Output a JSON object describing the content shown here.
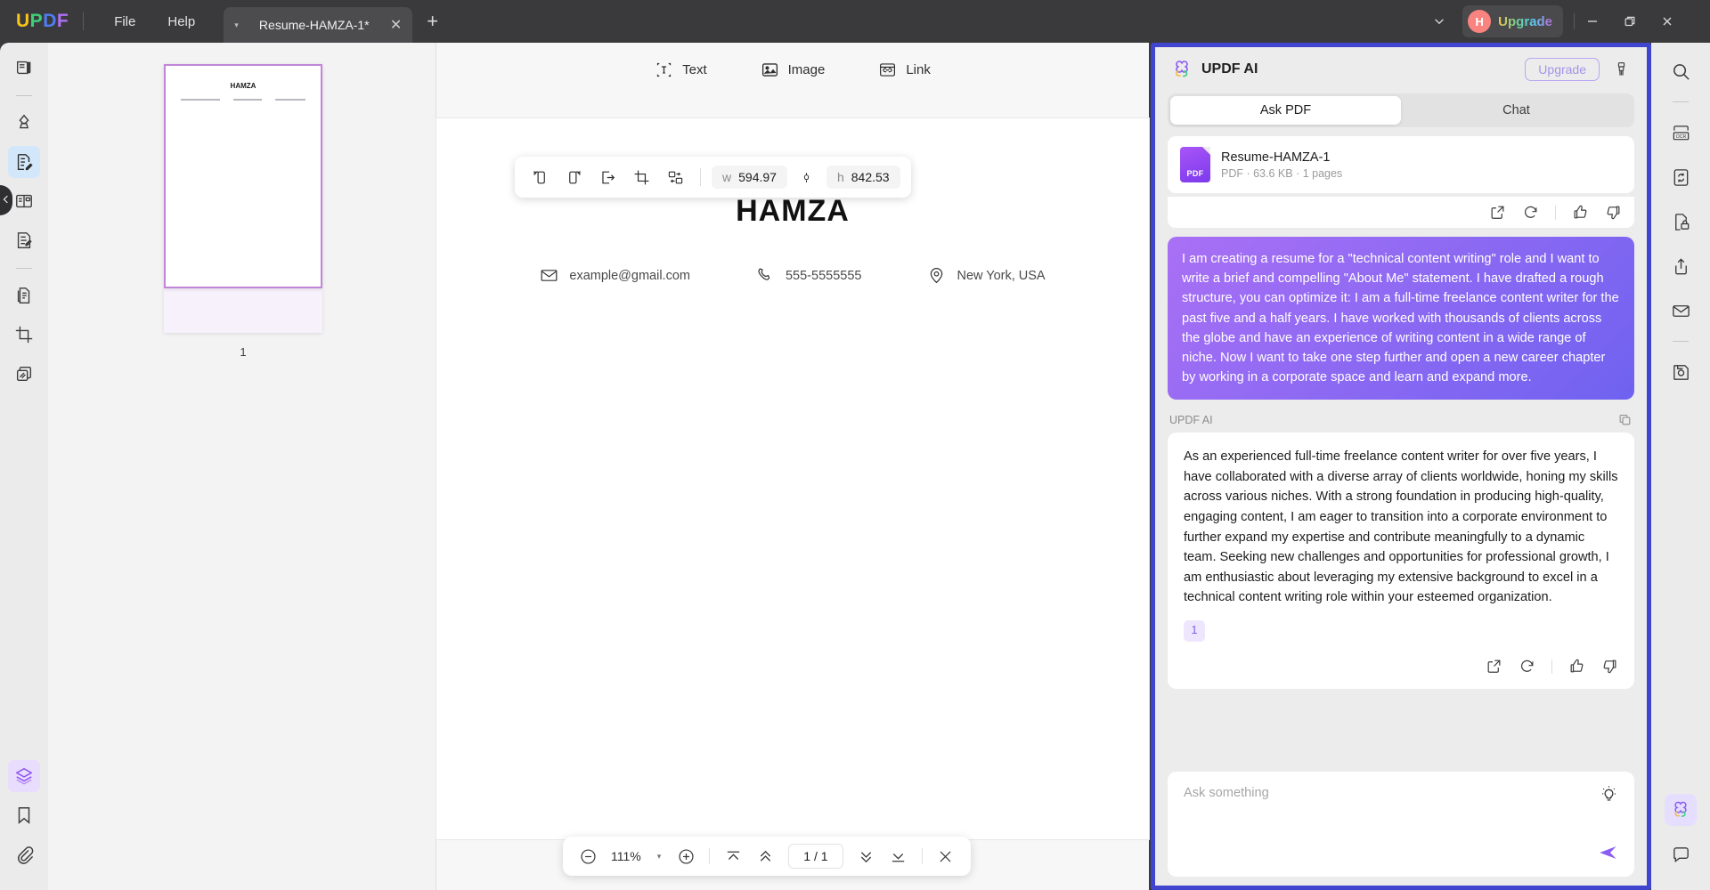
{
  "titlebar": {
    "logo": "UPDF",
    "menu": [
      {
        "label": "File"
      },
      {
        "label": "Help"
      }
    ],
    "tab": {
      "title": "Resume-HAMZA-1*",
      "close": "✕",
      "caret": "▾"
    },
    "new_tab": "+",
    "chevron": "⌄",
    "avatar_initial": "H",
    "upgrade_label": "Upgrade",
    "window": {
      "minimize": "—",
      "maximize": "❐",
      "close": "✕"
    }
  },
  "left_rail": {
    "items": [
      {
        "name": "reader-icon",
        "label": "Reader"
      },
      {
        "name": "comment-highlight-icon",
        "label": "Comment"
      },
      {
        "name": "edit-pdf-icon",
        "label": "Edit PDF",
        "active": true
      },
      {
        "name": "page-organize-icon",
        "label": "Organize Pages"
      },
      {
        "name": "form-edit-icon",
        "label": "Prepare Form"
      },
      {
        "name": "convert-icon",
        "label": "Convert"
      },
      {
        "name": "crop-icon",
        "label": "Crop"
      },
      {
        "name": "batch-icon",
        "label": "Batch"
      }
    ],
    "bottom_items": [
      {
        "name": "layers-icon",
        "label": "Layers",
        "active": true
      },
      {
        "name": "bookmark-icon",
        "label": "Bookmark"
      },
      {
        "name": "attachment-icon",
        "label": "Attachment"
      }
    ]
  },
  "thumbnails": {
    "page_label": "1",
    "doc_title": "HAMZA"
  },
  "edit_toolbar": [
    {
      "icon": "text-icon",
      "label": "Text"
    },
    {
      "icon": "image-icon",
      "label": "Image"
    },
    {
      "icon": "link-icon",
      "label": "Link"
    }
  ],
  "float_toolbar": {
    "buttons": [
      {
        "name": "rotate-left-icon"
      },
      {
        "name": "rotate-right-icon"
      },
      {
        "name": "extract-image-icon"
      },
      {
        "name": "crop-image-icon"
      },
      {
        "name": "replace-image-icon"
      }
    ],
    "width_label": "w",
    "width_value": "594.97",
    "lock_ratio_icon": "link-ratio-icon",
    "height_label": "h",
    "height_value": "842.53"
  },
  "document": {
    "name": "HAMZA",
    "email": "example@gmail.com",
    "phone": "555-5555555",
    "location": "New York, USA"
  },
  "zoombar": {
    "zoom_out": "−",
    "zoom_level": "111%",
    "dropdown_caret": "▾",
    "zoom_in": "+",
    "page_indicator": "1 / 1",
    "close": "✕"
  },
  "ai_panel": {
    "title": "UPDF AI",
    "upgrade_label": "Upgrade",
    "brush_icon": "clear-chat-icon",
    "tabs": [
      {
        "label": "Ask PDF",
        "active": true
      },
      {
        "label": "Chat",
        "active": false
      }
    ],
    "file_card": {
      "name": "Resume-HAMZA-1",
      "meta": "PDF · 63.6 KB · 1 pages"
    },
    "user_message": "I am creating a resume for a \"technical content writing\" role and I want to write a brief and compelling \"About Me\" statement. I have drafted a rough structure, you can optimize it: I am a full-time freelance content writer for the past five and a half years. I have worked with thousands of clients across the globe and have an experience of writing content in a wide range of niche. Now I want to take one step further and open a new career chapter by working in a corporate space and learn and expand more.",
    "ai_label": "UPDF AI",
    "ai_message": "As an experienced full-time freelance content writer for over five years, I have collaborated with a diverse array of clients worldwide, honing my skills across various niches. With a strong foundation in producing high-quality, engaging content, I am eager to transition into a corporate environment to further expand my expertise and contribute meaningfully to a dynamic team. Seeking new challenges and opportunities for professional growth, I am enthusiastic about leveraging my extensive background to excel in a technical content writing role within your esteemed organization.",
    "citation": "1",
    "actions": [
      {
        "name": "insert-icon"
      },
      {
        "name": "regenerate-icon"
      },
      {
        "name": "thumbs-up-icon"
      },
      {
        "name": "thumbs-down-icon"
      }
    ],
    "input_placeholder": "Ask something",
    "bulb_icon": "prompt-ideas-icon",
    "send_icon": "send-icon",
    "accent_color": "#4045cf",
    "user_bubble_color": "#7d6af2"
  },
  "right_rail": {
    "items": [
      {
        "name": "search-icon"
      },
      {
        "name": "ocr-icon"
      },
      {
        "name": "convert-sync-icon"
      },
      {
        "name": "protect-lock-icon"
      },
      {
        "name": "share-upload-icon"
      },
      {
        "name": "email-icon"
      },
      {
        "name": "save-icon"
      }
    ],
    "bottom_items": [
      {
        "name": "ai-assistant-icon"
      },
      {
        "name": "comment-bubble-icon"
      }
    ]
  }
}
